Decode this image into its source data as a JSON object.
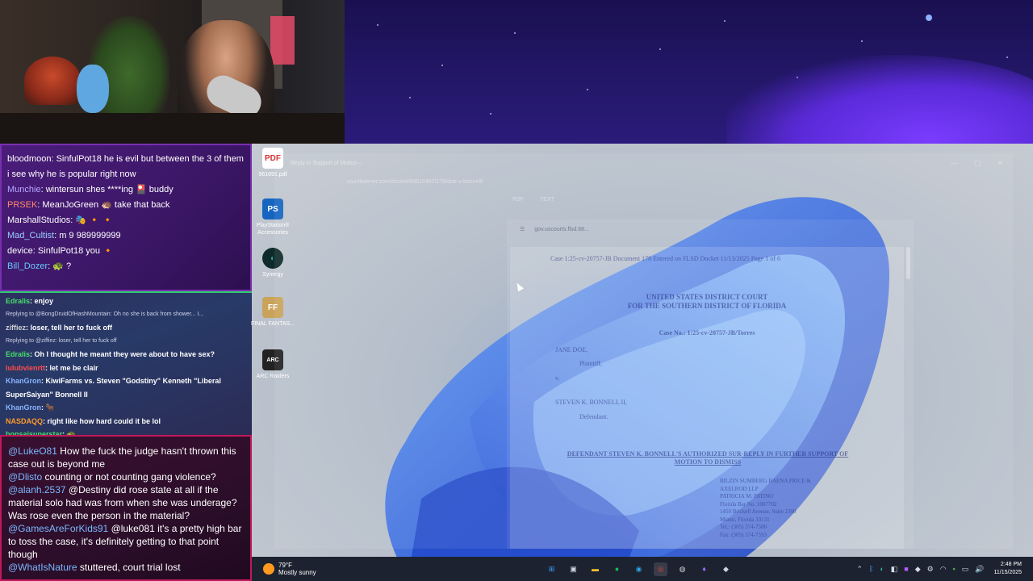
{
  "chat_top": {
    "messages": [
      {
        "user": "bloodmoon",
        "text": "SinfulPot18 he is evil but between the 3 of them i see why he is popular right now"
      },
      {
        "user": "Munchie",
        "text": "wintersun shes ****ing 🎴 buddy"
      },
      {
        "user": "PRSEK",
        "text": "MeanJoGreen 🦔 take that back"
      },
      {
        "user": "MarshallStudios",
        "text": "🎭 🔸 🔸"
      },
      {
        "user": "Mad_Cultist",
        "text": "m 9 989999999"
      },
      {
        "user": "device",
        "text": "SinfulPot18 you 🔸"
      },
      {
        "user": "Bill_Dozer",
        "text": "🐢 ?"
      }
    ]
  },
  "chat_mid": {
    "rows": [
      {
        "user": "Edralis",
        "text": "enjoy"
      },
      {
        "reply": "Replying to @BongDruidOfHashMountain: Oh no she is back from shower... I..."
      },
      {
        "user": "ziffiez",
        "text": "loser, tell her to fuck off"
      },
      {
        "reply": "Replying to @ziffiez: loser, tell her to fuck off"
      },
      {
        "user": "Edralis",
        "text": "Oh I thought he meant they were about to have sex?"
      },
      {
        "user": "lulubvienrtt",
        "text": "let me be clair"
      },
      {
        "user": "KhanGron",
        "text": "KiwiFarms vs. Steven \"Godstiny\" Kenneth \"Liberal"
      },
      {
        "text": "SuperSaiyan\" Bonnell II"
      },
      {
        "user": "KhanGron",
        "text": "🐂"
      },
      {
        "user": "NASDAQQ",
        "text": "right like how hard could it be lol"
      },
      {
        "user": "bonsaisuperstar",
        "text": "🐢"
      }
    ]
  },
  "chat_bottom": {
    "messages": [
      {
        "user": "@LukeO81",
        "text": "How the fuck the judge hasn't thrown this case out is beyond me"
      },
      {
        "user": "@Dlisto",
        "text": "counting or not counting gang violence?"
      },
      {
        "user": "@alanh.2537",
        "text": "@Destiny did rose state at all if the material solo had was from when she was underage? Was rose even the person in the material?"
      },
      {
        "user": "@GamesAreForKids91",
        "text": "@luke081 it's a pretty high bar to toss the case, it's definitely getting to that point though"
      },
      {
        "user": "@WhatIsNature",
        "text": "stuttered, court trial lost"
      }
    ]
  },
  "desktop_icons": [
    {
      "label": "961691.pdf",
      "glyph": "PDF",
      "color": "#d32f2f",
      "icon": "pdf-file-icon"
    },
    {
      "label": "PlayStation® Accessories",
      "glyph": "PS",
      "color": "#1565c0",
      "icon": "playstation-icon"
    },
    {
      "label": "Synergy",
      "glyph": "◐",
      "color": "#26a69a",
      "icon": "synergy-icon"
    },
    {
      "label": "FINAL FANTAS...",
      "glyph": "FF",
      "color": "#c9a35a",
      "icon": "final-fantasy-icon"
    },
    {
      "label": "ARC Raiders",
      "glyph": "ARC",
      "color": "#333333",
      "icon": "arc-raiders-icon"
    }
  ],
  "browser": {
    "tab_title": "Reply in Support of Motion –",
    "address": "courtlistener.com/docket/69610487/178/doe-v-bonnell/",
    "tools": [
      "PDF",
      "TEXT"
    ]
  },
  "pdf_viewer": {
    "toolbar_title": "gov.uscourts.flsd.68...",
    "header": "Case 1:25-cv-20757-JB   Document 178   Entered on FLSD Docket 11/13/2025   Page 1 of 6",
    "court_line1": "UNITED STATES DISTRICT COURT",
    "court_line2": "FOR THE SOUTHERN DISTRICT OF FLORIDA",
    "case_no": "Case No.: 1:25-cv-20757-JB/Torres",
    "plaintiff_name": "JANE DOE,",
    "plaintiff_role": "Plaintiff,",
    "versus": "v.",
    "defendant_name": "STEVEN K. BONNELL II,",
    "defendant_role": "Defendant.",
    "title": "DEFENDANT STEVEN K. BONNELL'S AUTHORIZED SUR-REPLY IN FURTHER SUPPORT OF MOTION TO DISMISS",
    "firm_lines": [
      "BILZIN SUMBERG BAENA PRICE &",
      "AXELROD LLP",
      "PATRICIA M. PATINO",
      "Florida Bar No. 1007702",
      "1450 Brickell Avenue, Suite 2300",
      "Miami, Florida 33131",
      "Tel.: (305) 374-7580",
      "Fax: (305) 374-7593"
    ]
  },
  "taskbar": {
    "weather_temp": "79°F",
    "weather_desc": "Mostly sunny",
    "apps": [
      {
        "icon": "windows-start-icon",
        "glyph": "⊞",
        "color": "#3aa0ff"
      },
      {
        "icon": "task-view-icon",
        "glyph": "▣",
        "color": "#cfd6e4"
      },
      {
        "icon": "file-explorer-icon",
        "glyph": "▬",
        "color": "#f2c230"
      },
      {
        "icon": "spotify-icon",
        "glyph": "●",
        "color": "#1db954"
      },
      {
        "icon": "edge-icon",
        "glyph": "◉",
        "color": "#2ba3e0"
      },
      {
        "icon": "chrome-icon",
        "glyph": "◎",
        "color": "#ea4335"
      },
      {
        "icon": "obs-icon",
        "glyph": "◍",
        "color": "#d0d0d0"
      },
      {
        "icon": "app-purple-icon",
        "glyph": "♦",
        "color": "#9a6bff"
      },
      {
        "icon": "steam-icon",
        "glyph": "◆",
        "color": "#c7d5e0"
      }
    ],
    "time": "2:48 PM",
    "date": "11/15/2025"
  }
}
